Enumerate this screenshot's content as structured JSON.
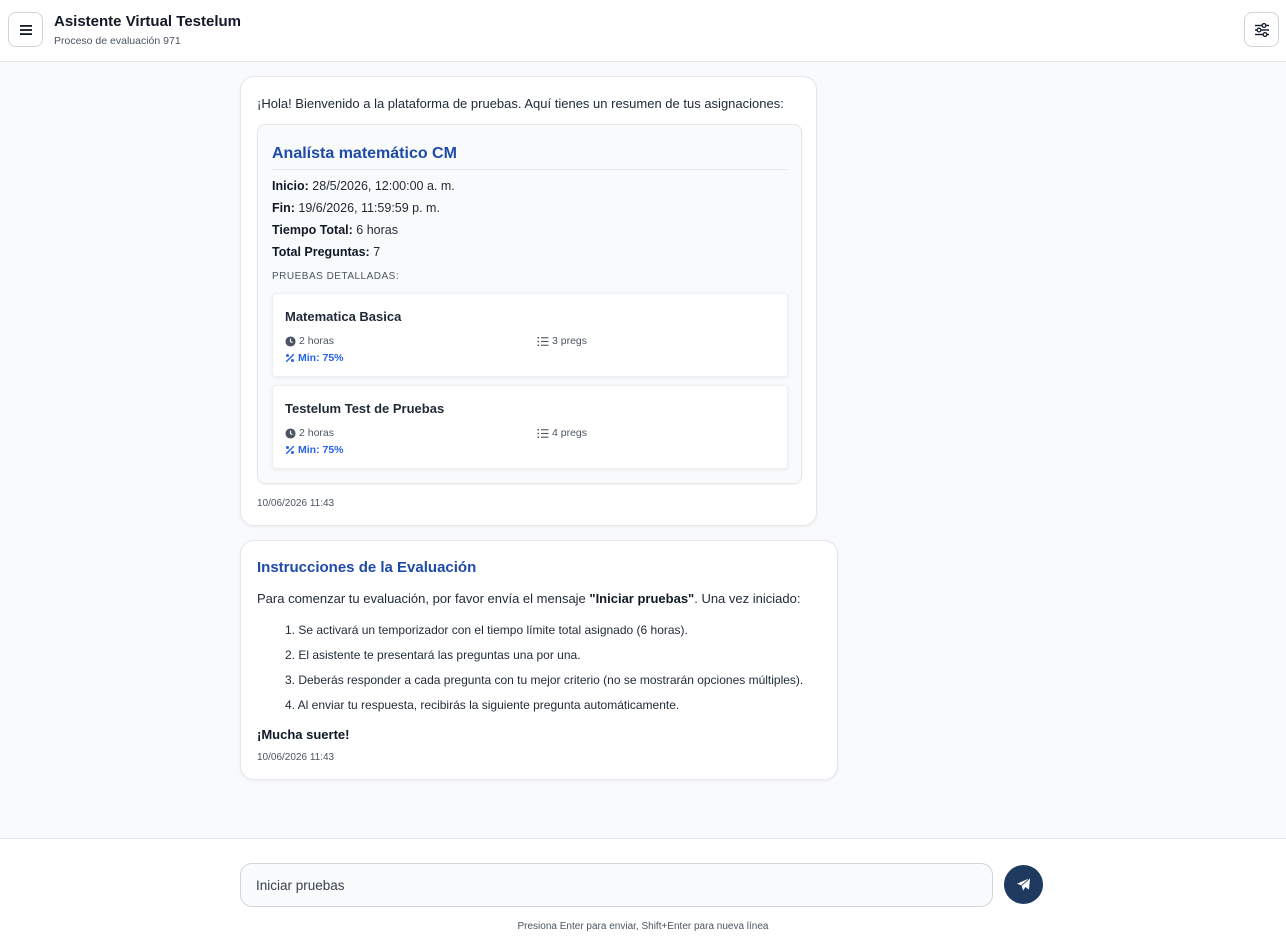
{
  "header": {
    "title": "Asistente Virtual Testelum",
    "subtitle": "Proceso de evaluación 971",
    "menu_icon": "hamburger-icon",
    "settings_icon": "sliders-icon"
  },
  "message1": {
    "intro": "¡Hola! Bienvenido a la plataforma de pruebas. Aquí tienes un resumen de tus asignaciones:",
    "assignment": {
      "title": "Analísta matemático CM",
      "start_label": "Inicio:",
      "start_value": "28/5/2026, 12:00:00 a. m.",
      "end_label": "Fin:",
      "end_value": "19/6/2026, 11:59:59 p. m.",
      "total_time_label": "Tiempo Total:",
      "total_time_value": "6 horas",
      "total_questions_label": "Total Preguntas:",
      "total_questions_value": "7",
      "details_heading": "PRUEBAS DETALLADAS:",
      "tests": [
        {
          "name": "Matematica Basica",
          "duration": "2 horas",
          "questions": "3 pregs",
          "min": "Min: 75%"
        },
        {
          "name": "Testelum Test de Pruebas",
          "duration": "2 horas",
          "questions": "4 pregs",
          "min": "Min: 75%"
        }
      ]
    },
    "timestamp": "10/06/2026 11:43"
  },
  "message2": {
    "title": "Instrucciones de la Evaluación",
    "intro_before": "Para comenzar tu evaluación, por favor envía el mensaje ",
    "intro_bold": "\"Iniciar pruebas\"",
    "intro_after": ". Una vez iniciado:",
    "steps": [
      "1. Se activará un temporizador con el tiempo límite total asignado (6 horas).",
      "2. El asistente te presentará las preguntas una por una.",
      "3. Deberás responder a cada pregunta con tu mejor criterio (no se mostrarán opciones múltiples).",
      "4. Al enviar tu respuesta, recibirás la siguiente pregunta automáticamente."
    ],
    "closing": "¡Mucha suerte!",
    "timestamp": "10/06/2026 11:43"
  },
  "composer": {
    "value": "Iniciar pruebas",
    "send_icon": "paper-plane-icon",
    "hint": "Presiona Enter para enviar, Shift+Enter para nueva línea"
  },
  "colors": {
    "accent": "#1e4aa8",
    "send_button": "#1e3a5f",
    "min_score": "#2563eb"
  }
}
